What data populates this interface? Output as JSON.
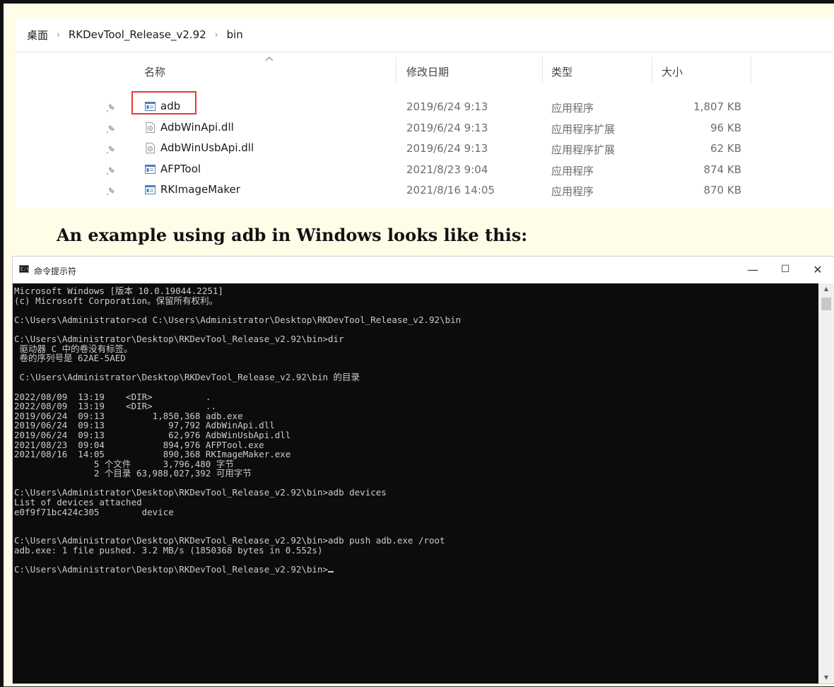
{
  "explorer": {
    "breadcrumb": [
      "桌面",
      "RKDevTool_Release_v2.92",
      "bin"
    ],
    "columns": {
      "name": "名称",
      "date": "修改日期",
      "type": "类型",
      "size": "大小"
    },
    "files": [
      {
        "name": "adb",
        "date": "2019/6/24 9:13",
        "type": "应用程序",
        "size": "1,807 KB",
        "icon": "app-icon",
        "highlighted": true
      },
      {
        "name": "AdbWinApi.dll",
        "date": "2019/6/24 9:13",
        "type": "应用程序扩展",
        "size": "96 KB",
        "icon": "dll-icon"
      },
      {
        "name": "AdbWinUsbApi.dll",
        "date": "2019/6/24 9:13",
        "type": "应用程序扩展",
        "size": "62 KB",
        "icon": "dll-icon"
      },
      {
        "name": "AFPTool",
        "date": "2021/8/23 9:04",
        "type": "应用程序",
        "size": "874 KB",
        "icon": "app-icon"
      },
      {
        "name": "RKImageMaker",
        "date": "2021/8/16 14:05",
        "type": "应用程序",
        "size": "870 KB",
        "icon": "app-icon"
      }
    ],
    "highlight_color": "#e53935"
  },
  "caption": "An example using adb in Windows looks like this:",
  "cmd": {
    "title": "命令提示符",
    "icon_text": "C:\\",
    "controls": {
      "minimize": "—",
      "maximize": "☐",
      "close": "✕"
    },
    "lines": [
      "Microsoft Windows [版本 10.0.19044.2251]",
      "(c) Microsoft Corporation。保留所有权利。",
      "",
      "C:\\Users\\Administrator>cd C:\\Users\\Administrator\\Desktop\\RKDevTool_Release_v2.92\\bin",
      "",
      "C:\\Users\\Administrator\\Desktop\\RKDevTool_Release_v2.92\\bin>dir",
      " 驱动器 C 中的卷没有标签。",
      " 卷的序列号是 62AE-5AED",
      "",
      " C:\\Users\\Administrator\\Desktop\\RKDevTool_Release_v2.92\\bin 的目录",
      "",
      "2022/08/09  13:19    <DIR>          .",
      "2022/08/09  13:19    <DIR>          ..",
      "2019/06/24  09:13         1,850,368 adb.exe",
      "2019/06/24  09:13            97,792 AdbWinApi.dll",
      "2019/06/24  09:13            62,976 AdbWinUsbApi.dll",
      "2021/08/23  09:04           894,976 AFPTool.exe",
      "2021/08/16  14:05           890,368 RKImageMaker.exe",
      "               5 个文件      3,796,480 字节",
      "               2 个目录 63,988,027,392 可用字节",
      "",
      "C:\\Users\\Administrator\\Desktop\\RKDevTool_Release_v2.92\\bin>adb devices",
      "List of devices attached",
      "e0f9f71bc424c305        device",
      "",
      "",
      "C:\\Users\\Administrator\\Desktop\\RKDevTool_Release_v2.92\\bin>adb push adb.exe /root",
      "adb.exe: 1 file pushed. 3.2 MB/s (1850368 bytes in 0.552s)",
      "",
      "C:\\Users\\Administrator\\Desktop\\RKDevTool_Release_v2.92\\bin>"
    ]
  }
}
